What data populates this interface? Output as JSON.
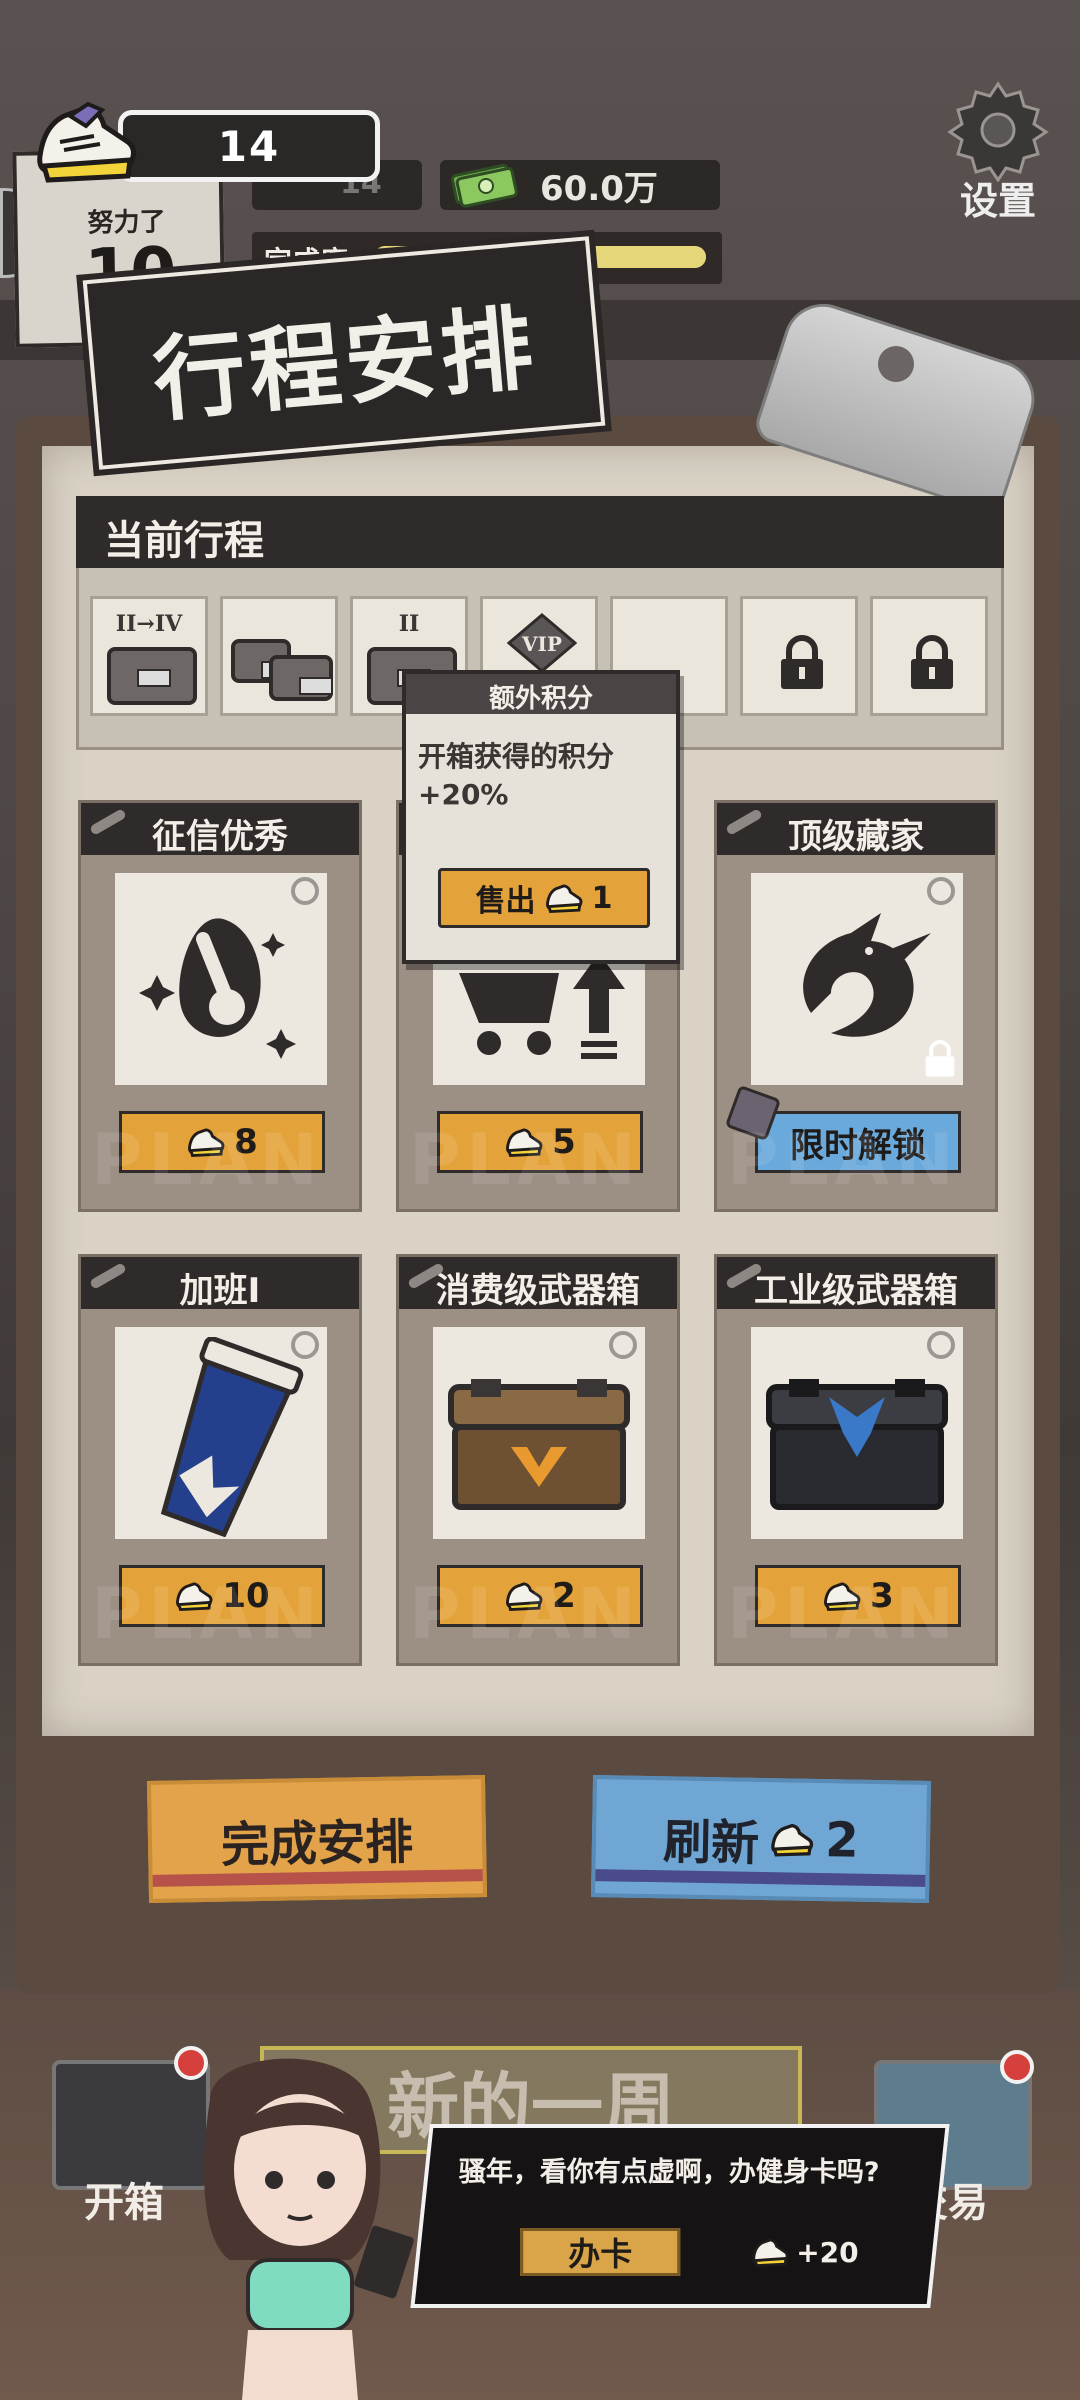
{
  "hud": {
    "level": "14",
    "money": "60.0万",
    "settings_label": "设置",
    "effort_label": "努力了",
    "effort_value": "10",
    "completion_label": "完成度",
    "completion_pct": "100%",
    "completion_fraction": 1.0,
    "shoe_count": "14"
  },
  "title": "行程安排",
  "itinerary": {
    "header": "当前行程",
    "slots": [
      {
        "tag": "II→IV",
        "type": "crate"
      },
      {
        "tag": "",
        "type": "crates"
      },
      {
        "tag": "II",
        "type": "crate"
      },
      {
        "tag": "VIP",
        "type": "vip"
      },
      {
        "tag": "",
        "type": "empty"
      },
      {
        "tag": "",
        "type": "locked"
      },
      {
        "tag": "",
        "type": "locked"
      }
    ]
  },
  "tooltip": {
    "title": "额外积分",
    "body": "开箱获得的积分+20%",
    "sell_label": "售出",
    "sell_cost": "1"
  },
  "cards": [
    {
      "title": "征信优秀",
      "price": "8",
      "icon": "egg-sparkle-icon",
      "locked": false
    },
    {
      "title": "",
      "price": "5",
      "icon": "cart-upgrade-icon",
      "locked": false
    },
    {
      "title": "顶级藏家",
      "price": "限时解锁",
      "icon": "dragon-icon",
      "locked": true
    },
    {
      "title": "加班I",
      "price": "10",
      "icon": "coffee-cup-icon",
      "locked": false
    },
    {
      "title": "消费级武器箱",
      "price": "2",
      "icon": "wooden-crate-icon",
      "locked": false
    },
    {
      "title": "工业级武器箱",
      "price": "3",
      "icon": "black-crate-icon",
      "locked": false
    }
  ],
  "buttons": {
    "finish": "完成安排",
    "refresh": "刷新",
    "refresh_cost": "2"
  },
  "bottom": {
    "left_nav": "开箱",
    "right_nav": "交易",
    "week_banner": "新的一周",
    "speech": "骚年，看你有点虚啊，办健身卡吗?",
    "speech_button": "办卡",
    "reward": "+20"
  },
  "colors": {
    "accent_orange": "#e4a33a",
    "accent_blue": "#6aa9db",
    "dark": "#2f2b2a",
    "paper": "#d9d2c5"
  }
}
